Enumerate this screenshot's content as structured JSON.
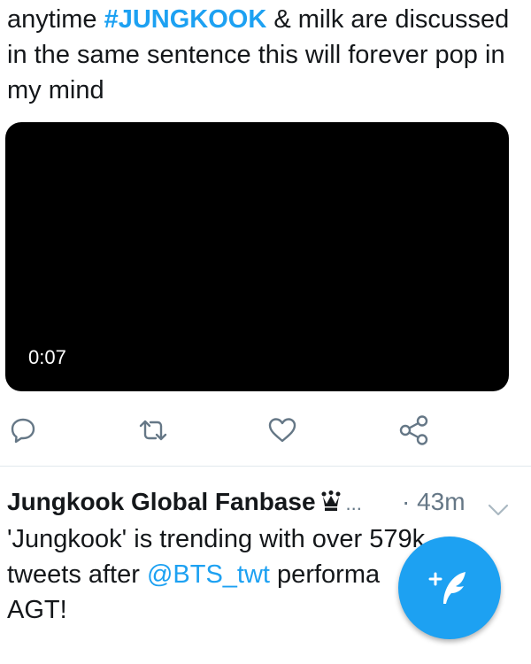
{
  "tweet1": {
    "text_before": "anytime ",
    "hashtag": "#JUNGKOOK",
    "text_after": " & milk are discussed in the same sentence this will forever pop in my mind",
    "video": {
      "duration": "0:07"
    },
    "actions": [
      {
        "name": "reply",
        "icon": "reply-icon"
      },
      {
        "name": "retweet",
        "icon": "retweet-icon"
      },
      {
        "name": "like",
        "icon": "heart-icon"
      },
      {
        "name": "share",
        "icon": "share-icon"
      }
    ]
  },
  "tweet2": {
    "author": "Jungkook Global Fanbase",
    "author_badge": "crown-icon",
    "ellipsis": "...",
    "time": "· 43m",
    "line1": "'Jungkook' is trending with over 57",
    "line1_cut": "9k",
    "line2_before": "tweets after ",
    "mention": "@BTS_twt",
    "line2_after": " performa",
    "line3": "AGT!"
  },
  "compose_button": {
    "icon": "compose-feather-icon"
  },
  "colors": {
    "accent": "#1da1f2",
    "text": "#14171a",
    "secondary": "#657786",
    "divider": "#e1e8ed"
  }
}
